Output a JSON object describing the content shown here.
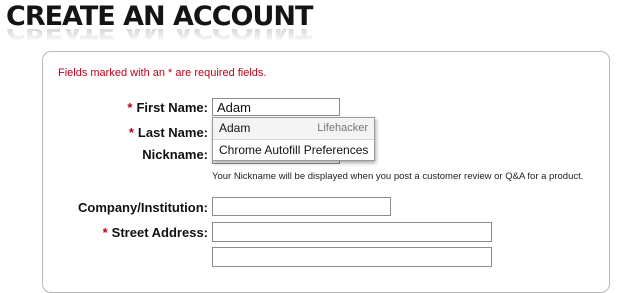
{
  "header": {
    "title": "CREATE AN ACCOUNT"
  },
  "form": {
    "required_note": "Fields marked with an * are required fields.",
    "required_mark": "*",
    "first_name": {
      "label": "First Name:",
      "value": "Adam"
    },
    "last_name": {
      "label": "Last Name:"
    },
    "nickname": {
      "label": "Nickname:",
      "hint": "Your Nickname will be displayed when you post a customer review or Q&A for a product."
    },
    "company": {
      "label": "Company/Institution:"
    },
    "street": {
      "label": "Street Address:"
    }
  },
  "autofill": {
    "suggestion": {
      "name": "Adam",
      "source": "Lifehacker"
    },
    "preferences_label": "Chrome Autofill Preferences"
  },
  "colors": {
    "required": "#c0001a",
    "border": "#b8b8b8"
  }
}
